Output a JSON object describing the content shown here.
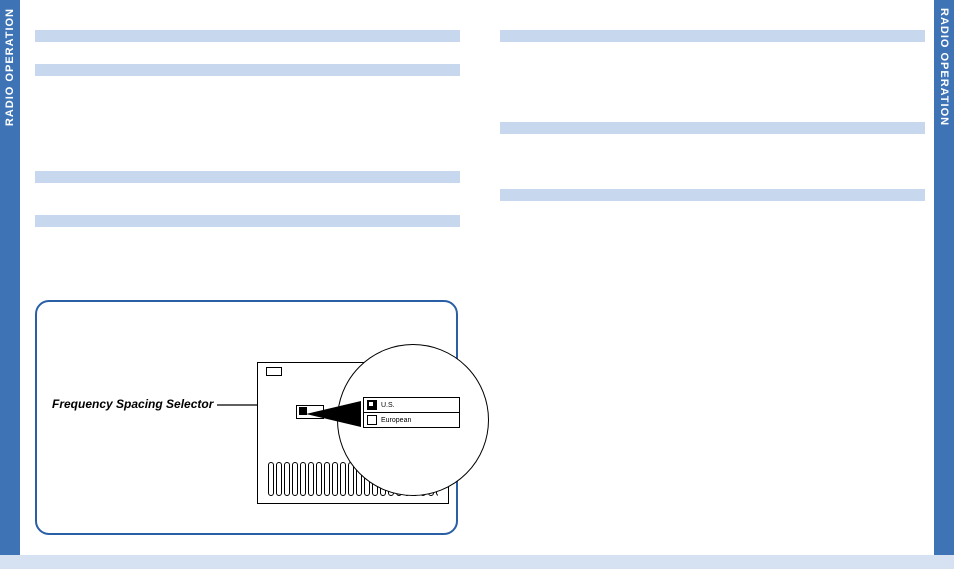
{
  "side_tabs": {
    "left": "RADIO OPERATION",
    "right": "RADIO OPERATION"
  },
  "figure": {
    "callout_label": "Frequency Spacing Selector",
    "switch_options": {
      "option_a": "U.S.",
      "option_b": "European"
    }
  }
}
